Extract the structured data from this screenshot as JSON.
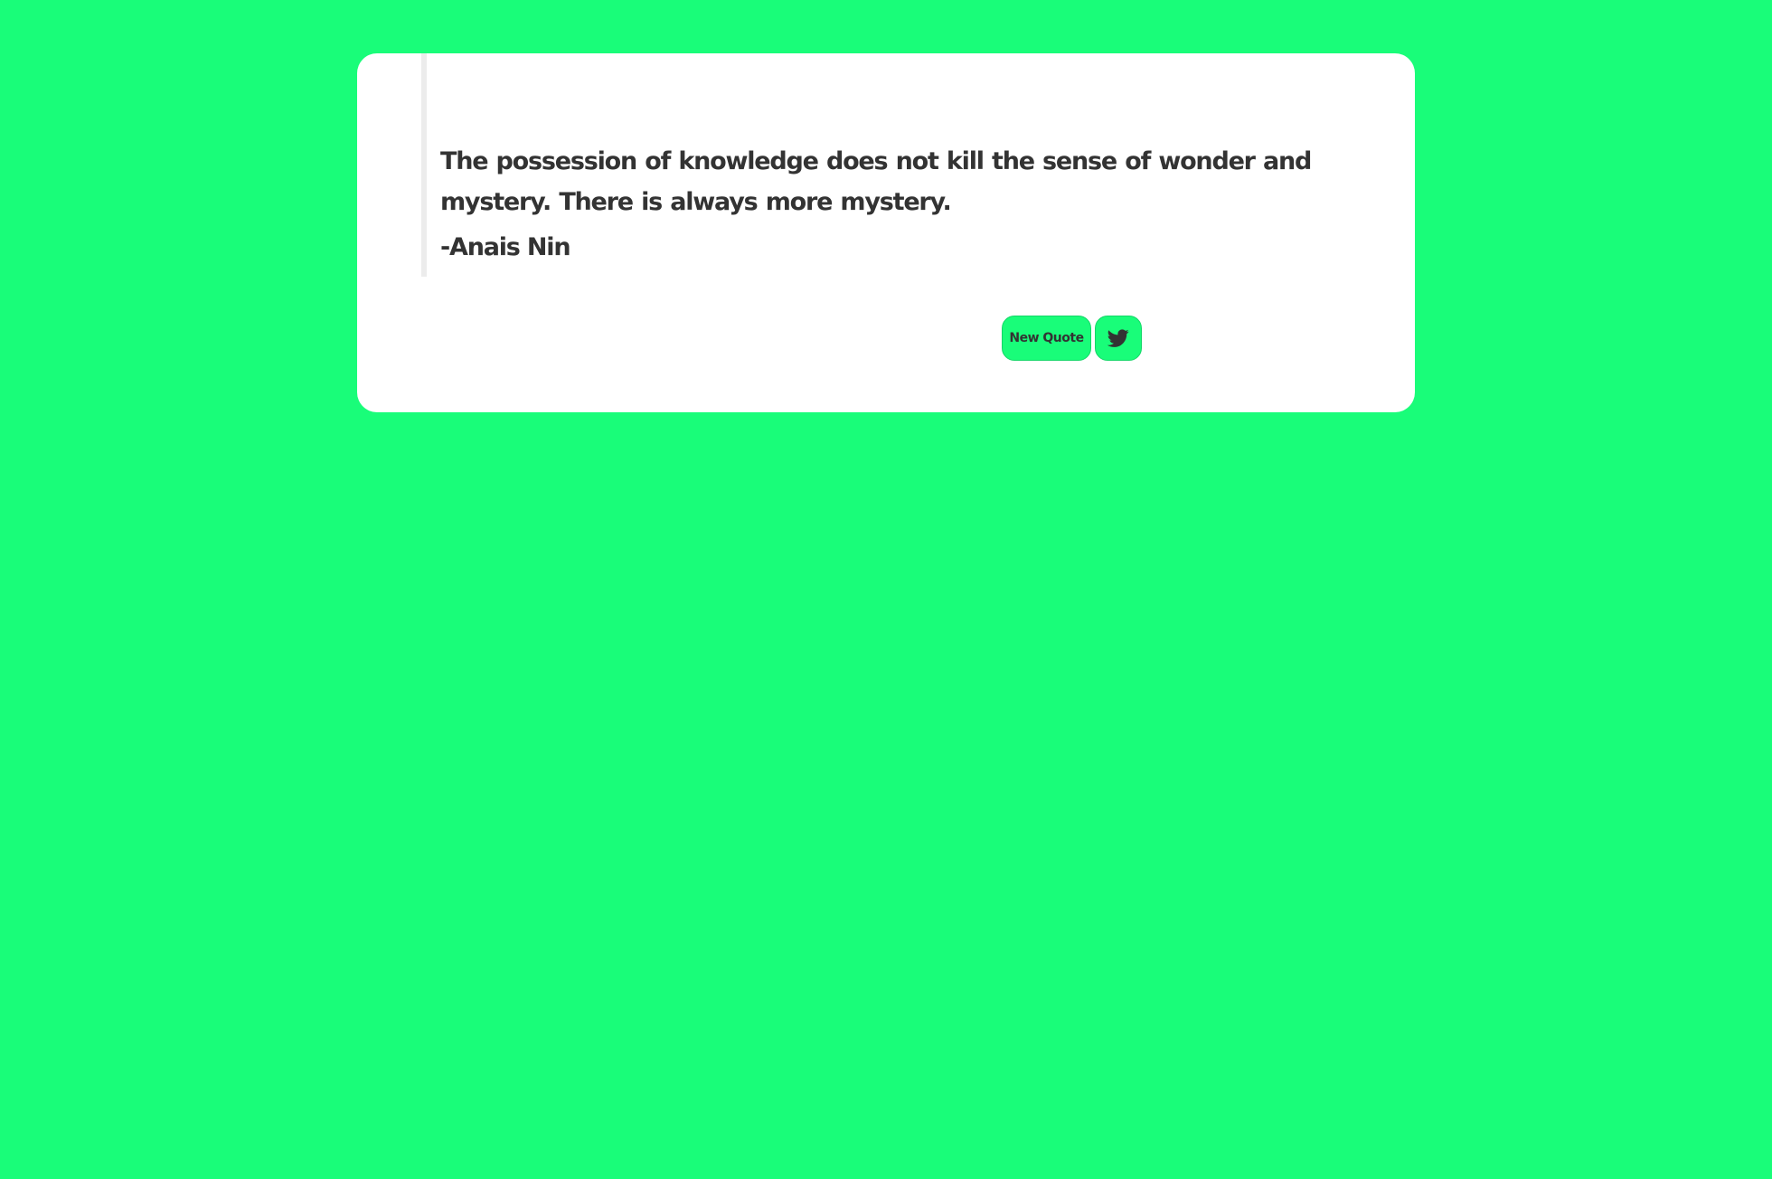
{
  "theme": {
    "background": "#19fd79",
    "card": "#ffffff",
    "text": "#333333",
    "quote_border": "#ececec",
    "button": "#19fd79"
  },
  "quote": {
    "text": "The possession of knowledge does not kill the sense of wonder and mystery. There is always more mystery.",
    "author": "-Anais Nin"
  },
  "actions": {
    "new_quote_label": "New Quote",
    "tweet_icon": "twitter-icon"
  }
}
